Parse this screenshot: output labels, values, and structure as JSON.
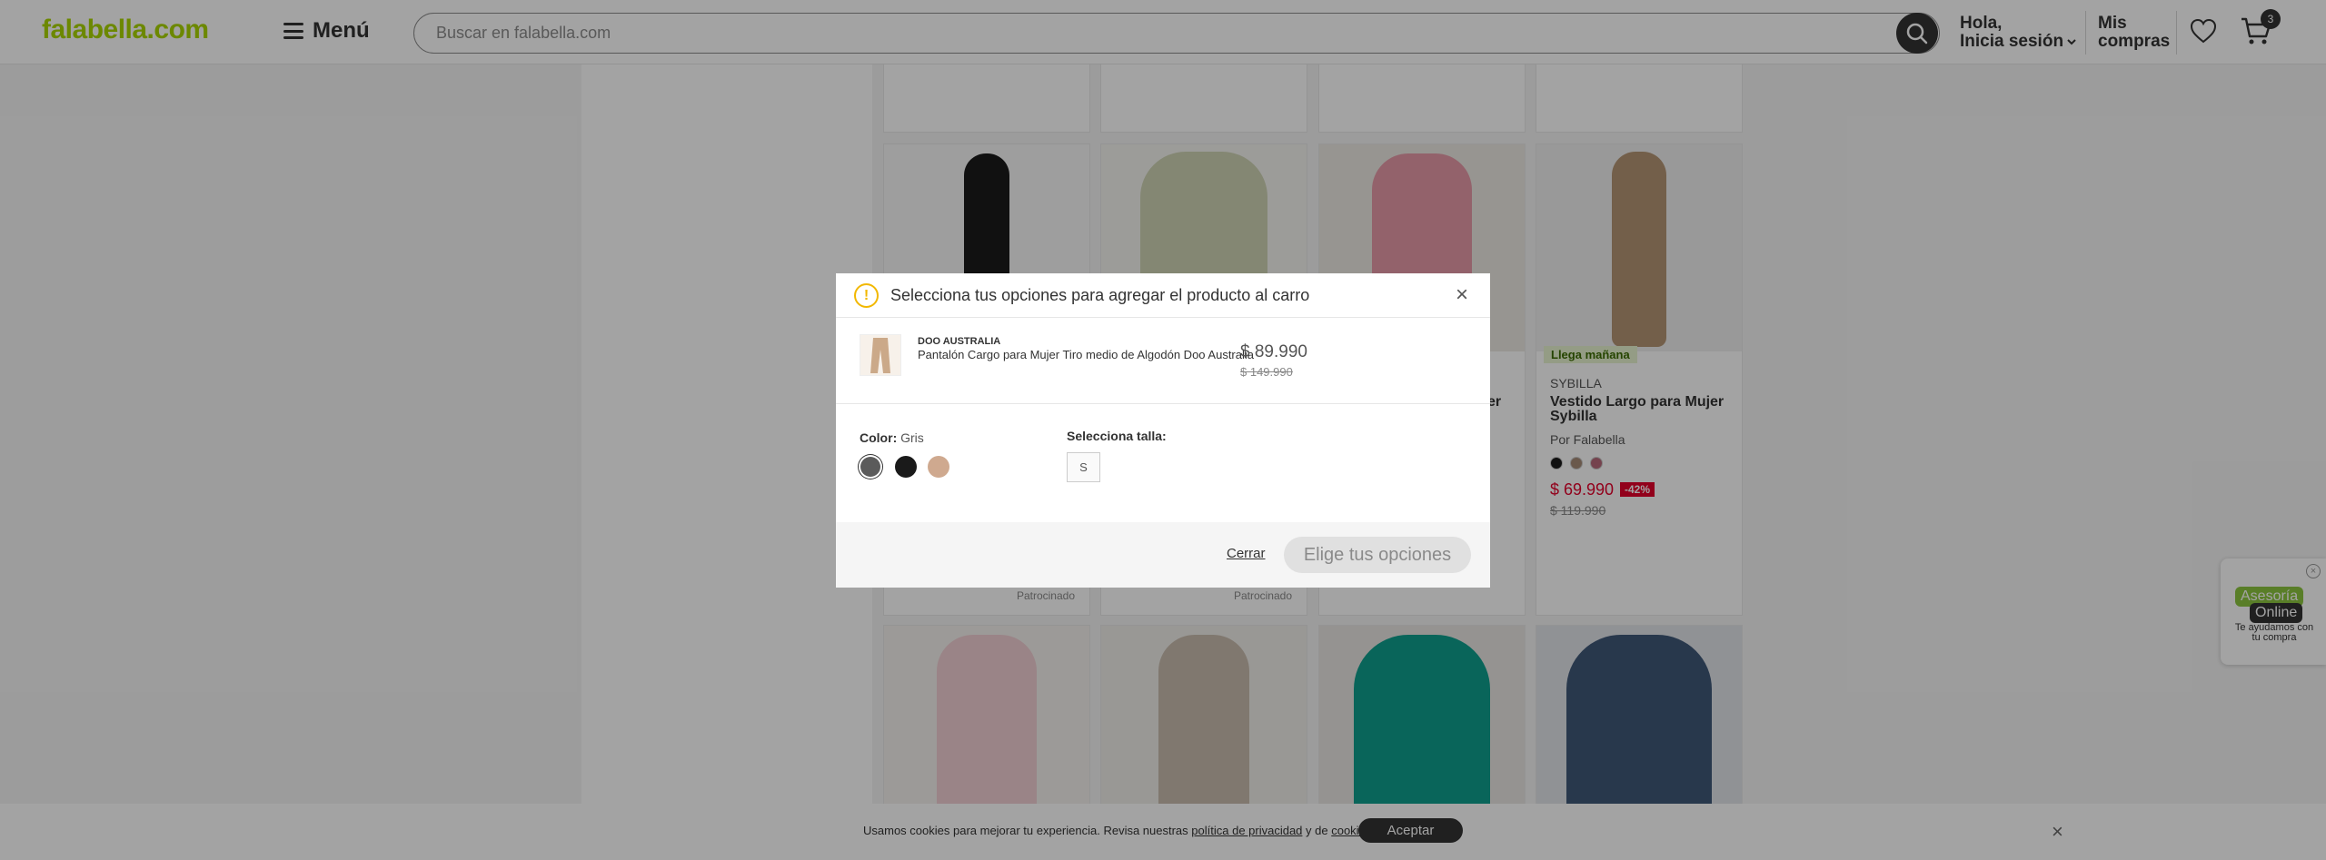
{
  "header": {
    "logo": "falabella.com",
    "menu_label": "Menú",
    "search_placeholder": "Buscar en falabella.com",
    "user_line1": "Hola,",
    "user_line2": "Inicia sesión",
    "compras_line1": "Mis",
    "compras_line2": "compras",
    "cart_count": "3"
  },
  "products": [
    {
      "tag": "",
      "brand": "",
      "title": "",
      "seller": "",
      "price": "",
      "old_price": "",
      "discount": "",
      "sponsored": "Patrocinado"
    },
    {
      "tag": "",
      "brand": "",
      "title": "",
      "seller": "",
      "price": "",
      "old_price": "",
      "discount": "",
      "sponsored": "Patrocinado"
    },
    {
      "tag": "",
      "brand": "",
      "title": "er",
      "seller": "",
      "price": "",
      "old_price": "",
      "discount": "",
      "sponsored": ""
    },
    {
      "tag": "Llega mañana",
      "brand": "SYBILLA",
      "title": "Vestido Largo para Mujer Sybilla",
      "seller": "Por Falabella",
      "price": "$ 69.990",
      "old_price": "$ 119.990",
      "discount": "-42%",
      "sponsored": ""
    }
  ],
  "cookie": {
    "text_before": "Usamos cookies para mejorar tu experiencia. Revisa nuestras ",
    "privacy_link": "política de privacidad",
    "text_middle": " y de ",
    "cookies_link": "cookies",
    "text_after": ".",
    "accept_label": "Aceptar"
  },
  "chat": {
    "line1": "Asesoría",
    "line2": "Online",
    "subtitle": "Te ayudamos con tu compra"
  },
  "modal": {
    "title": "Selecciona tus opciones para agregar el producto al carro",
    "product": {
      "brand": "DOO AUSTRALIA",
      "name": "Pantalón Cargo para Mujer Tiro medio de Algodón Doo Australia",
      "price": "$ 89.990",
      "old_price": "$ 149.990"
    },
    "color_label": "Color",
    "color_value": "Gris",
    "colors": [
      "#5b5b5b",
      "#1a1a1a",
      "#cfa98f"
    ],
    "size_label": "Selecciona talla:",
    "sizes": [
      "S"
    ],
    "close_label": "Cerrar",
    "confirm_label": "Elige tus opciones"
  }
}
